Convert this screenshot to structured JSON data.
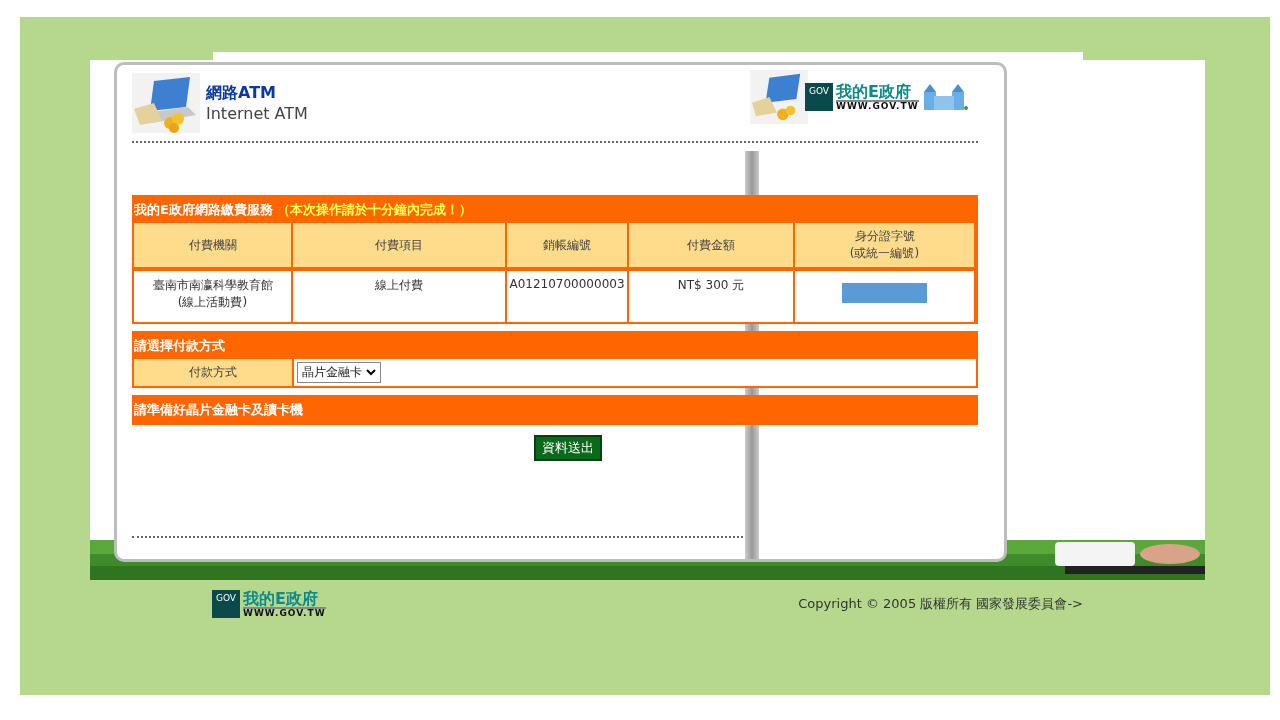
{
  "header": {
    "title": "網路ATM",
    "subtitle": "Internet ATM"
  },
  "top_logo": {
    "badge": "GOV",
    "name": "我的E政府",
    "url": "WWW.GOV.TW"
  },
  "service": {
    "title": "我的E政府網路繳費服務",
    "notice": "（本次操作請於十分鐘內完成！）",
    "columns": [
      {
        "lines": [
          "付費機關"
        ]
      },
      {
        "lines": [
          "付費項目"
        ]
      },
      {
        "lines": [
          "銷帳編號"
        ]
      },
      {
        "lines": [
          "付費金額"
        ]
      },
      {
        "lines": [
          "身分證字號",
          "(或統一編號)"
        ]
      }
    ],
    "rows": [
      [
        {
          "kind": "text",
          "lines": [
            "臺南市南瀛科學教育館",
            "(線上活動費)"
          ]
        },
        {
          "kind": "text",
          "lines": [
            "線上付費"
          ]
        },
        {
          "kind": "text",
          "lines": [
            "A01210700000003"
          ]
        },
        {
          "kind": "text",
          "lines": [
            "NT$ 300 元"
          ]
        },
        {
          "kind": "redacted"
        }
      ]
    ]
  },
  "payment": {
    "title": "請選擇付款方式",
    "label": "付款方式",
    "value": "晶片金融卡"
  },
  "instruction": "請準備好晶片金融卡及讀卡機",
  "submit": "資料送出",
  "footer": {
    "logo": {
      "badge": "GOV",
      "name": "我的E政府",
      "url": "WWW.GOV.TW"
    },
    "copyright": "Copyright © 2005 版權所有 國家發展委員會->"
  }
}
